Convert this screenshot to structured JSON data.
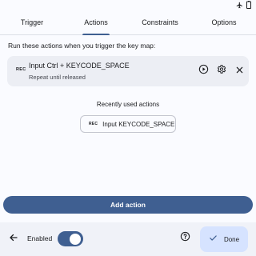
{
  "status_bar": {
    "icons": [
      "airplane-icon",
      "battery-icon"
    ]
  },
  "tabs": [
    {
      "label": "Trigger",
      "active": false
    },
    {
      "label": "Actions",
      "active": true
    },
    {
      "label": "Constraints",
      "active": false
    },
    {
      "label": "Options",
      "active": false
    }
  ],
  "main": {
    "instructions": "Run these actions when you trigger the key map:",
    "action": {
      "icon_text": "REC",
      "title": "Input Ctrl + KEYCODE_SPACE",
      "subtitle": "Repeat until released"
    },
    "recently_used_label": "Recently used actions",
    "recent_chip": {
      "icon_text": "REC",
      "label": "Input KEYCODE_SPACE"
    },
    "add_action_label": "Add action"
  },
  "bottom_bar": {
    "enabled_label": "Enabled",
    "enabled": true,
    "done_label": "Done"
  },
  "colors": {
    "accent": "#3f5f91",
    "done_bg": "#d6e3ff",
    "card_bg": "#eceef4"
  }
}
